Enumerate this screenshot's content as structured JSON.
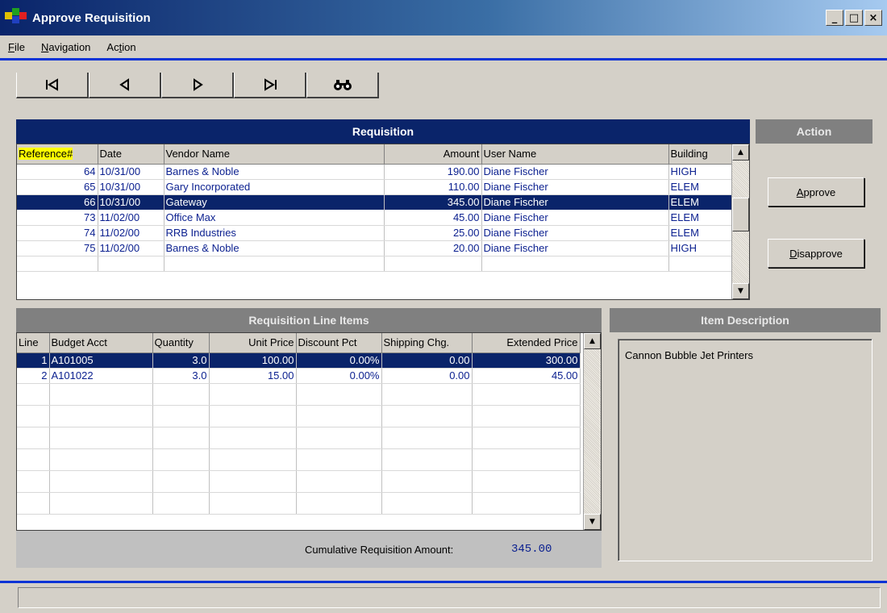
{
  "window": {
    "title": "Approve Requisition",
    "minimize": "_",
    "maximize": "□",
    "close": "×"
  },
  "menu": [
    {
      "pre": "",
      "u": "F",
      "post": "ile"
    },
    {
      "pre": "",
      "u": "N",
      "post": "avigation"
    },
    {
      "pre": "Ac",
      "u": "t",
      "post": "ion"
    }
  ],
  "toolbar": {
    "first": "⏮",
    "prev": "◀",
    "next": "▶",
    "last": "⏭",
    "find": "🔭"
  },
  "requisition": {
    "title": "Requisition",
    "columns": [
      "Reference#",
      "Date",
      "Vendor Name",
      "Amount",
      "User Name",
      "Building"
    ],
    "rows": [
      [
        "64",
        "10/31/00",
        "Barnes & Noble",
        "190.00",
        "Diane Fischer",
        "HIGH"
      ],
      [
        "65",
        "10/31/00",
        "Gary Incorporated",
        "110.00",
        "Diane Fischer",
        "ELEM"
      ],
      [
        "66",
        "10/31/00",
        "Gateway",
        "345.00",
        "Diane Fischer",
        "ELEM"
      ],
      [
        "73",
        "11/02/00",
        "Office Max",
        "45.00",
        "Diane Fischer",
        "ELEM"
      ],
      [
        "74",
        "11/02/00",
        "RRB Industries",
        "25.00",
        "Diane Fischer",
        "ELEM"
      ],
      [
        "75",
        "11/02/00",
        "Barnes & Noble",
        "20.00",
        "Diane Fischer",
        "HIGH"
      ]
    ],
    "selected_index": 2
  },
  "action": {
    "title": "Action",
    "approve": {
      "u": "A",
      "rest": "pprove"
    },
    "disapprove": {
      "u": "D",
      "rest": "isapprove"
    }
  },
  "line_items": {
    "title": "Requisition Line Items",
    "columns": [
      "Line",
      "Budget Acct",
      "Quantity",
      "Unit Price",
      "Discount Pct",
      "Shipping Chg.",
      "Extended Price"
    ],
    "rows": [
      [
        "1",
        "A101005",
        "3.0",
        "100.00",
        "0.00%",
        "0.00",
        "300.00"
      ],
      [
        "2",
        "A101022",
        "3.0",
        "15.00",
        "0.00%",
        "0.00",
        "45.00"
      ]
    ],
    "selected_index": 0
  },
  "item_description": {
    "title": "Item Description",
    "text": "Cannon Bubble Jet Printers"
  },
  "cumulative": {
    "label": "Cumulative Requisition Amount:",
    "value": "345.00"
  },
  "colors": {
    "title_bar_start": "#0a246a",
    "accent_line": "#0b33d6",
    "selection": "#0a246a",
    "header_highlight": "#ffff00",
    "cell_text": "#0a1f8f"
  }
}
